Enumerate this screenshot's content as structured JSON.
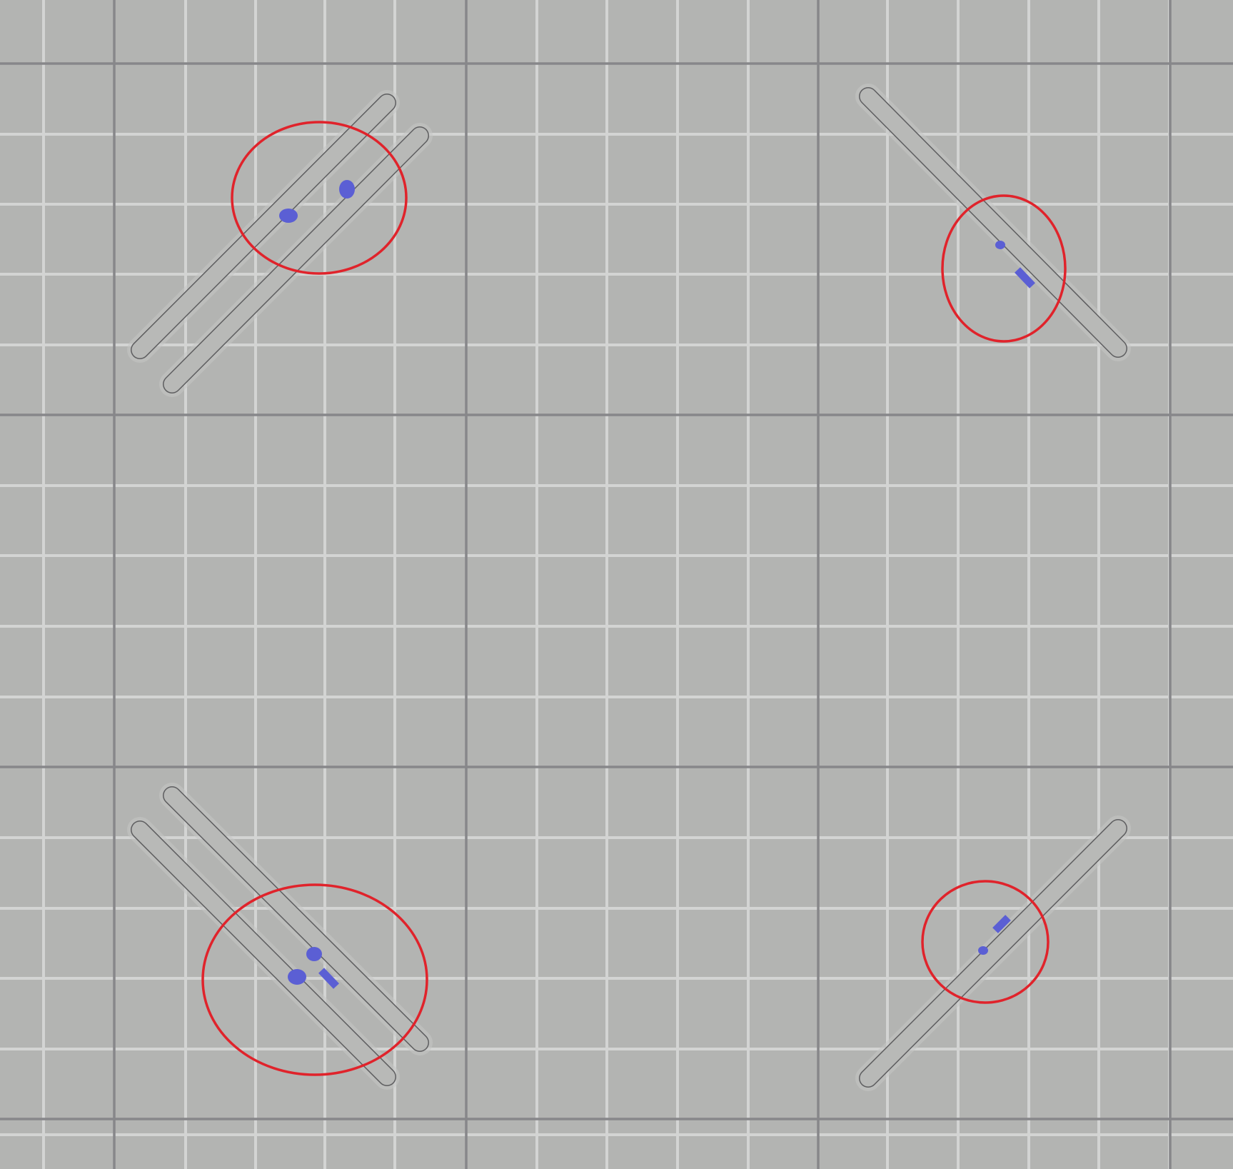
{
  "view": {
    "background_color": "#b3b4b2",
    "minor_grid_color": "#d3d4d3",
    "major_grid_color": "#87878a",
    "part_body_color": "#b8b9b7",
    "part_outline_color": "#5e5e60",
    "part_halo_color": "#c6c7c5",
    "overhang_marker_color": "#5b5fd4",
    "highlight_circle_color": "#e0232b"
  },
  "clusters": [
    {
      "name": "top-left",
      "part_count": 2,
      "highlighted": true
    },
    {
      "name": "top-right",
      "part_count": 1,
      "highlighted": true
    },
    {
      "name": "bottom-left",
      "part_count": 2,
      "highlighted": true
    },
    {
      "name": "bottom-right",
      "part_count": 1,
      "highlighted": true
    }
  ]
}
